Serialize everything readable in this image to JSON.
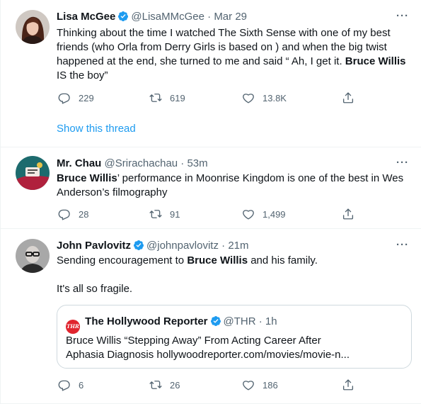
{
  "tweets": [
    {
      "name": "Lisa McGee",
      "handle": "@LisaMMcGee",
      "sep": "·",
      "time": "Mar 29",
      "more": "···",
      "text_1": "Thinking about the time I watched The Sixth Sense with one of my best",
      "text_2": "friends (who Orla from Derry Girls is based on ) and when the big twist",
      "text_3": "happened at the end, she turned to me and said “ Ah, I get it. ",
      "text_3_bold": "Bruce Willis",
      "text_4": "IS the boy”",
      "replies": "229",
      "retweets": "619",
      "likes": "13.8K",
      "show_thread": "Show this thread"
    },
    {
      "name": "Mr. Chau",
      "handle": "@Srirachachau",
      "sep": "·",
      "time": "53m",
      "more": "···",
      "text_1_bold": "Bruce Willis",
      "text_1": "’ performance in Moonrise Kingdom is one of the best in Wes",
      "text_2": "Anderson’s filmography",
      "replies": "28",
      "retweets": "91",
      "likes": "1,499"
    },
    {
      "name": "John Pavlovitz",
      "handle": "@johnpavlovitz",
      "sep": "·",
      "time": "21m",
      "more": "···",
      "text_1a": "Sending encouragement to ",
      "text_1_bold": "Bruce Willis",
      "text_1b": " and his family.",
      "text_2": "It's all so fragile.",
      "quote": {
        "logo_text": "THR",
        "name": "The Hollywood Reporter",
        "handle": "@THR",
        "sep": "·",
        "time": "1h",
        "line_1": "Bruce Willis “Stepping Away” From Acting Career After",
        "line_2": "Aphasia Diagnosis hollywoodreporter.com/movies/movie-n..."
      },
      "replies": "6",
      "retweets": "26",
      "likes": "186"
    }
  ],
  "icons": {
    "reply": "reply-icon",
    "retweet": "retweet-icon",
    "like": "like-icon",
    "share": "share-icon",
    "verified": "verified-badge-icon"
  },
  "colors": {
    "link": "#1d9bf0",
    "secondary": "#536471",
    "verified": "#1d9bf0",
    "thr_red": "#e0242e"
  }
}
